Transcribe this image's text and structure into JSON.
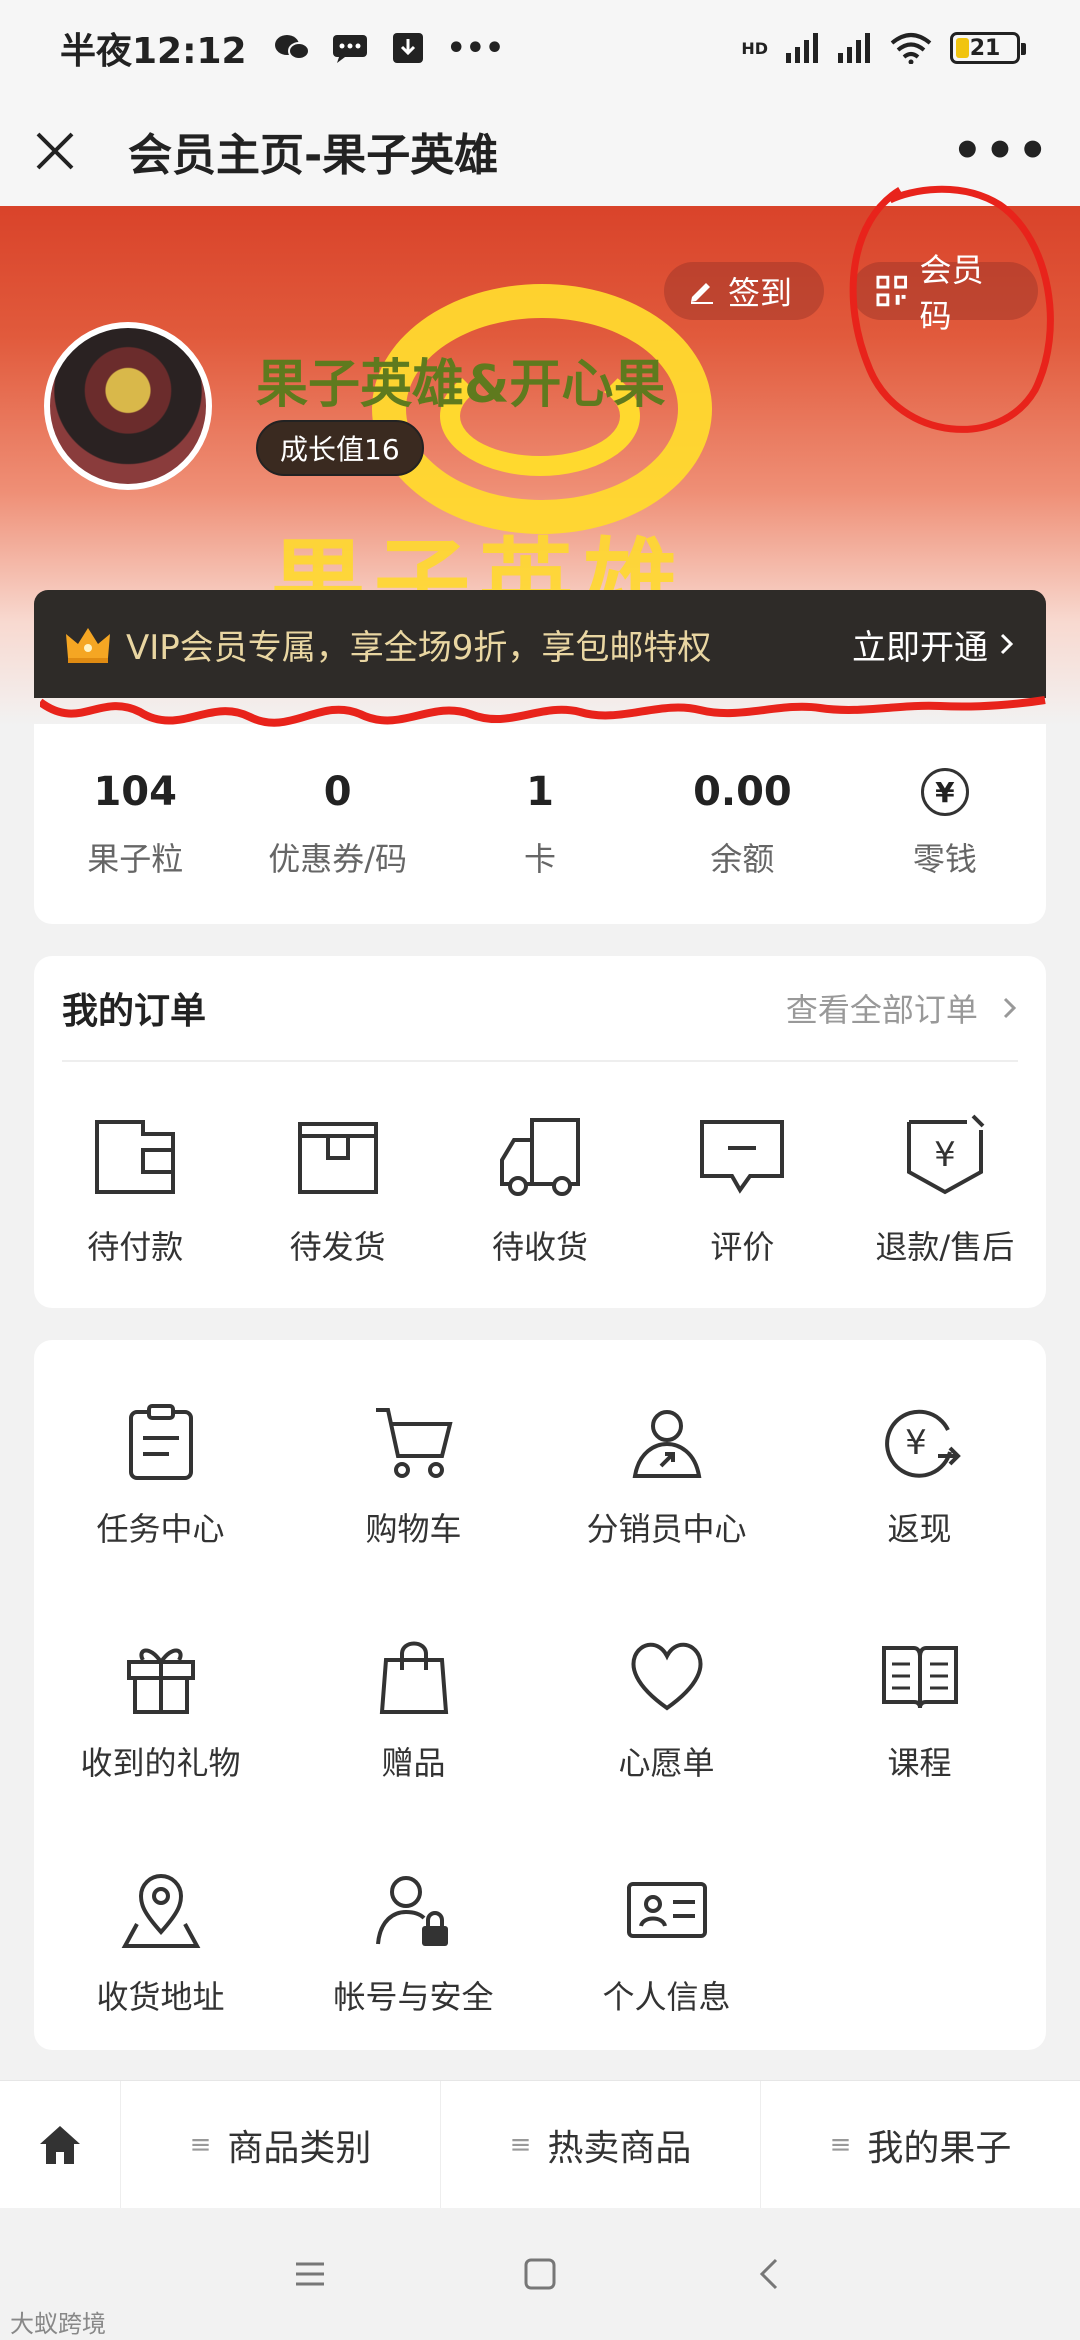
{
  "status_bar": {
    "time": "半夜12:12",
    "network_label": "HD",
    "battery": "21",
    "battery_level": 0.21
  },
  "title_bar": {
    "title": "会员主页-果子英雄",
    "more": "•••"
  },
  "header": {
    "checkin_label": "签到",
    "member_code_label": "会员码",
    "nickname": "果子英雄&开心果",
    "growth": "成长值16",
    "banner_text": "果子英雄"
  },
  "vip": {
    "text": "VIP会员专属，享全场9折，享包邮特权",
    "action": "立即开通"
  },
  "stats": [
    {
      "value": "104",
      "label": "果子粒"
    },
    {
      "value": "0",
      "label": "优惠券/码"
    },
    {
      "value": "1",
      "label": "卡"
    },
    {
      "value": "0.00",
      "label": "余额"
    },
    {
      "value": "",
      "label": "零钱",
      "icon": "yen-circle-icon"
    }
  ],
  "orders": {
    "title": "我的订单",
    "view_all": "查看全部订单",
    "items": [
      {
        "label": "待付款",
        "icon": "wallet-icon"
      },
      {
        "label": "待发货",
        "icon": "box-icon"
      },
      {
        "label": "待收货",
        "icon": "truck-icon"
      },
      {
        "label": "评价",
        "icon": "comment-icon"
      },
      {
        "label": "退款/售后",
        "icon": "refund-icon"
      }
    ]
  },
  "services": [
    {
      "label": "任务中心",
      "icon": "clipboard-icon"
    },
    {
      "label": "购物车",
      "icon": "cart-icon"
    },
    {
      "label": "分销员中心",
      "icon": "distributor-icon"
    },
    {
      "label": "返现",
      "icon": "cashback-icon"
    },
    {
      "label": "收到的礼物",
      "icon": "gift-icon"
    },
    {
      "label": "赠品",
      "icon": "bag-icon"
    },
    {
      "label": "心愿单",
      "icon": "heart-icon"
    },
    {
      "label": "课程",
      "icon": "book-icon"
    },
    {
      "label": "收货地址",
      "icon": "location-icon"
    },
    {
      "label": "帐号与安全",
      "icon": "user-lock-icon"
    },
    {
      "label": "个人信息",
      "icon": "id-card-icon"
    }
  ],
  "bottom_nav": {
    "items": [
      {
        "label": "商品类别"
      },
      {
        "label": "热卖商品"
      },
      {
        "label": "我的果子"
      }
    ]
  },
  "watermark": "大蚁跨境",
  "colors": {
    "banner_red": "#d9432a",
    "vip_bar": "#2e2b28",
    "vip_text": "#e9d6a2",
    "nickname": "#5f7a1e",
    "logo_yellow": "#ffd92e",
    "annotation_red": "#e8231b"
  }
}
